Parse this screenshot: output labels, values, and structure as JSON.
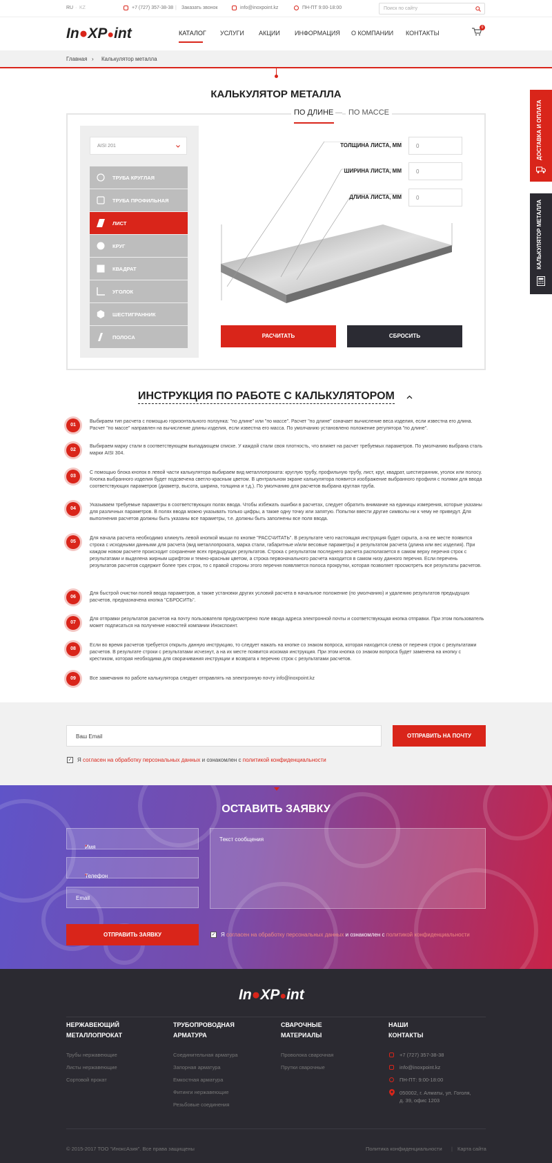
{
  "topbar": {
    "lang_ru": "RU",
    "lang_kz": "KZ",
    "phone": "+7 (727) 357-38-38",
    "callback": "Заказать звонок",
    "email": "info@inoxpoint.kz",
    "hours": "ПН-ПТ 9:00-18:00",
    "search_placeholder": "Поиск по сайту"
  },
  "header": {
    "logo_a": "In",
    "logo_b": "X",
    "logo_c": "P",
    "logo_d": "int",
    "nav": [
      "КАТАЛОГ",
      "УСЛУГИ",
      "АКЦИИ",
      "ИНФОРМАЦИЯ",
      "О КОМПАНИИ",
      "КОНТАКТЫ"
    ],
    "cart_count": "0"
  },
  "breadcrumb": {
    "home": "Главная",
    "sep": "›",
    "current": "Калькулятор металла"
  },
  "calc": {
    "title": "КАЛЬКУЛЯТОР МЕТАЛЛА",
    "tab_length": "ПО ДЛИНЕ",
    "tab_mass": "ПО МАССЕ",
    "steel": "AISI 201",
    "types": [
      "ТРУБА КРУГЛАЯ",
      "ТРУБА ПРОФИЛЬНАЯ",
      "ЛИСТ",
      "КРУГ",
      "КВАДРАТ",
      "УГОЛОК",
      "ШЕСТИГРАННИК",
      "ПОЛОСА"
    ],
    "fields": [
      {
        "label": "ТОЛЩИНА ЛИСТА, ММ",
        "value": "0"
      },
      {
        "label": "ШИРИНА ЛИСТА, ММ",
        "value": "0"
      },
      {
        "label": "ДЛИНА ЛИСТА, ММ",
        "value": "0"
      }
    ],
    "calc_btn": "РАСЧИТАТЬ",
    "reset_btn": "СБРОСИТЬ"
  },
  "side": {
    "delivery": "ДОСТАВКА И ОПЛАТА",
    "calculator": "КАЛЬКУЛЯТОР МЕТАЛЛА"
  },
  "instructions": {
    "title": "ИНСТРУКЦИЯ ПО РАБОТЕ С КАЛЬКУЛЯТОРОМ",
    "steps": [
      {
        "num": "01",
        "text": "Выбираем тип расчета с помощью горизонтального ползунка: \"по длине\" или \"по массе\". Расчет \"по длине\" означает вычисление веса изделия, если известна его длина. Расчет \"по массе\" направлен на вычисление длины изделия, если известна его масса. По умолчанию установлено положение регулятора \"по длине\"."
      },
      {
        "num": "02",
        "text": "Выбираем марку стали в соответствующем выпадающем списке. У каждой стали своя плотность, что влияет на расчет требуемых параметров. По умолчанию выбрана сталь марки AISI 304."
      },
      {
        "num": "03",
        "text": "С помощью блока кнопок в левой части калькулятора выбираем вид металлопроката: круглую трубу, профильную трубу, лист, круг, квадрат, шестигранник, уголок или полосу. Кнопка выбранного изделия будет подсвечена светло-красным цветом. В центральном экране калькулятора появится изображение выбранного профиля с полями для ввода соответствующих параметров (диаметр, высота, ширина, толщина и т.д.). По умолчанию для расчетов выбрана круглая труба."
      },
      {
        "num": "04",
        "text": "Указываем требуемые параметры в соответствующих полях ввода. Чтобы избежать ошибки в расчетах, следует обратить внимание на единицы измерения, которые указаны для различных параметров. В полях ввода можно указывать только цифры, а также одну точку или запятую. Попытки ввести другие символы ни к чему не приведут. Для выполнения расчетов должны быть указаны все параметры, т.е. должны быть заполнены все поля ввода."
      },
      {
        "num": "05",
        "text": "Для начала расчета необходимо кликнуть левой кнопкой мыши по кнопке \"РАССЧИТАТЬ\". В результате чего настоящая инструкция будет скрыта, а на ее месте появится строка с исходными данными для расчета (вид металлопроката, марка стали, габаритные и/или весовые параметры) и результатом расчета (длина или вес изделия). При каждом новом расчете происходит сохранение всех предыдущих результатов. Строка с результатом последнего расчета располагается в самом верху перечня строк с результатами и выделена жирным шрифтом и темно-красным цветом, а строка первоначального расчета находится в самом низу данного перечня. Если перечень результатов расчетов содержит более трех строк, то с правой стороны этого перечня появляется полоса прокрутки, которая позволяет просмотреть все результаты расчетов."
      },
      {
        "num": "06",
        "text": "Для быстрой очистки полей ввода параметров, а также установки других условий расчета в начальное положение (по умолчанию) и удалению результатов предыдущих расчетов, предназначена кнопка \"СБРОСИТЬ\"."
      },
      {
        "num": "07",
        "text": "Для отправки результатов расчетов на почту пользователя предусмотрено поле ввода адреса электронной почты и соответствующая кнопка отправки. При этом пользователь может подписаться на получение новостей компании Инокспоинт."
      },
      {
        "num": "08",
        "text": "Если во время расчетов требуется открыть данную инструкцию, то следует нажать на кнопке со знаком вопроса, которая находится слева от перечня строк с результатами расчетов. В результате строки с результатами исчезнут, а на их месте появится искомая инструкция. При этом кнопка со знаком вопроса будет заменена на кнопку с крестиком, которая необходима для сворачивания инструкции и возврата к перечню строк с результатами расчетов."
      },
      {
        "num": "09",
        "text": "Все замечания по работе калькулятора следует отправлять на электронную почту info@inoxpoint.kz"
      }
    ]
  },
  "email_form": {
    "placeholder": "Ваш Email",
    "button": "ОТПРАВИТЬ НА ПОЧТУ",
    "agree_a": "Я ",
    "agree_link1": "согласен на обработку персональных данных",
    "agree_b": " и ознакомлен с ",
    "agree_link2": "политикой конфиденциальности"
  },
  "request": {
    "title": "ОСТАВИТЬ ЗАЯВКУ",
    "name": "Имя",
    "phone": "Телефон",
    "email": "Email",
    "message": "Текст сообщения",
    "required_mark": "*",
    "button": "ОТПРАВИТЬ ЗАЯВКУ"
  },
  "footer": {
    "columns": [
      {
        "title": "НЕРЖАВЕЮЩИЙ МЕТАЛЛОПРОКАТ",
        "links": [
          "Трубы нержавеющие",
          "Листы нержавеющие",
          "Сортовой прокат"
        ]
      },
      {
        "title": "ТРУБОПРОВОДНАЯ АРМАТУРА",
        "links": [
          "Соединительная арматура",
          "Запорная арматура",
          "Емкостная арматура",
          "Фитинги нержавеющие",
          "Резьбовые соединения"
        ]
      },
      {
        "title": "СВАРОЧНЫЕ МАТЕРИАЛЫ",
        "links": [
          "Проволока сварочная",
          "Прутки сварочные"
        ]
      },
      {
        "title": "НАШИ КОНТАКТЫ",
        "links": [
          "+7 (727) 357-38-38",
          "info@inoxpoint.kz",
          "ПН-ПТ: 9:00-18:00",
          "050002, г. Алматы, ул. Гоголя, д. 39, офис 1203"
        ]
      }
    ],
    "copyright": "© 2015-2017 ТОО \"ИноксАзия\". Все права защищены",
    "privacy": "Политика конфиденциальности",
    "sitemap": "Карта сайта"
  },
  "colors": {
    "accent": "#d9251a",
    "dark": "#2b2a31",
    "panel_gray": "#bdbdbd"
  }
}
